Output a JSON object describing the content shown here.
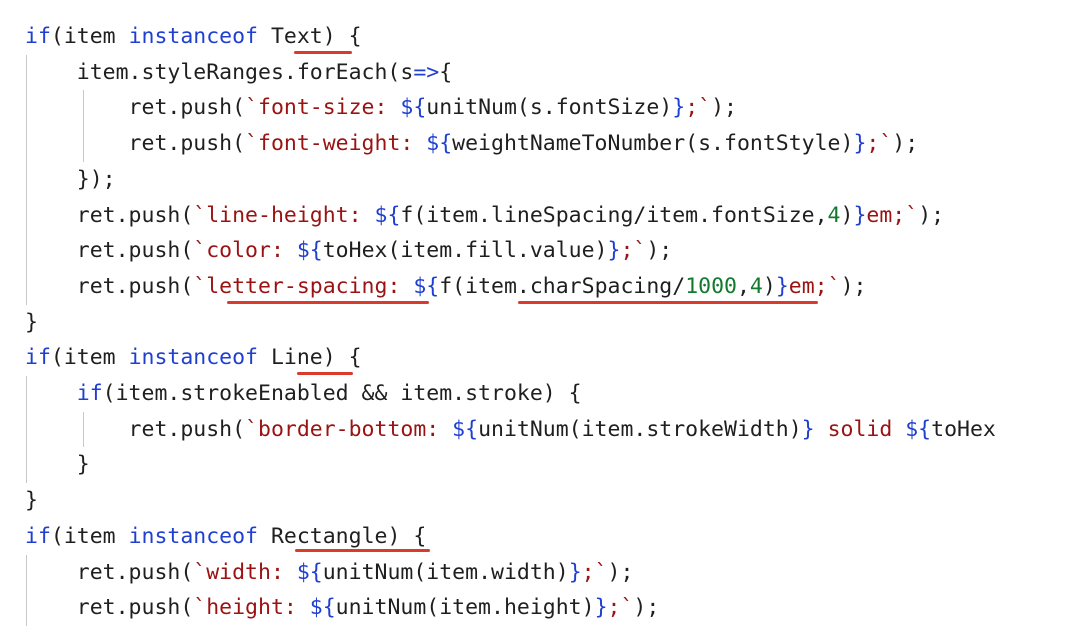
{
  "editor": {
    "lines": [
      [
        [
          "kw",
          "if"
        ],
        [
          "plain",
          "(item "
        ],
        [
          "kw",
          "instanceof"
        ],
        [
          "plain",
          " Text) {"
        ]
      ],
      [
        [
          "plain",
          "    item.styleRanges.forEach(s"
        ],
        [
          "kw",
          "=>"
        ],
        [
          "plain",
          "{"
        ]
      ],
      [
        [
          "plain",
          "        ret.push("
        ],
        [
          "str",
          "`font-size: "
        ],
        [
          "tpl",
          "${"
        ],
        [
          "plain",
          "unitNum(s.fontSize)"
        ],
        [
          "tpl",
          "}"
        ],
        [
          "str",
          ";`"
        ],
        [
          "plain",
          ");"
        ]
      ],
      [
        [
          "plain",
          "        ret.push("
        ],
        [
          "str",
          "`font-weight: "
        ],
        [
          "tpl",
          "${"
        ],
        [
          "plain",
          "weightNameToNumber(s.fontStyle)"
        ],
        [
          "tpl",
          "}"
        ],
        [
          "str",
          ";`"
        ],
        [
          "plain",
          ");"
        ]
      ],
      [
        [
          "plain",
          "    });"
        ]
      ],
      [
        [
          "plain",
          "    ret.push("
        ],
        [
          "str",
          "`line-height: "
        ],
        [
          "tpl",
          "${"
        ],
        [
          "plain",
          "f(item.lineSpacing/item.fontSize,"
        ],
        [
          "num",
          "4"
        ],
        [
          "plain",
          ")"
        ],
        [
          "tpl",
          "}"
        ],
        [
          "str",
          "em;`"
        ],
        [
          "plain",
          ");"
        ]
      ],
      [
        [
          "plain",
          "    ret.push("
        ],
        [
          "str",
          "`color: "
        ],
        [
          "tpl",
          "${"
        ],
        [
          "plain",
          "toHex(item.fill.value)"
        ],
        [
          "tpl",
          "}"
        ],
        [
          "str",
          ";`"
        ],
        [
          "plain",
          ");"
        ]
      ],
      [
        [
          "plain",
          "    ret.push("
        ],
        [
          "str",
          "`letter-spacing: "
        ],
        [
          "tpl",
          "${"
        ],
        [
          "plain",
          "f(item.charSpacing/"
        ],
        [
          "num",
          "1000"
        ],
        [
          "plain",
          ","
        ],
        [
          "num",
          "4"
        ],
        [
          "plain",
          ")"
        ],
        [
          "tpl",
          "}"
        ],
        [
          "str",
          "em;`"
        ],
        [
          "plain",
          ");"
        ]
      ],
      [
        [
          "plain",
          "}"
        ]
      ],
      [
        [
          "kw",
          "if"
        ],
        [
          "plain",
          "(item "
        ],
        [
          "kw",
          "instanceof"
        ],
        [
          "plain",
          " Line) {"
        ]
      ],
      [
        [
          "plain",
          "    "
        ],
        [
          "kw",
          "if"
        ],
        [
          "plain",
          "(item.strokeEnabled && item.stroke) {"
        ]
      ],
      [
        [
          "plain",
          "        ret.push("
        ],
        [
          "str",
          "`border-bottom: "
        ],
        [
          "tpl",
          "${"
        ],
        [
          "plain",
          "unitNum(item.strokeWidth)"
        ],
        [
          "tpl",
          "}"
        ],
        [
          "str",
          " solid "
        ],
        [
          "tpl",
          "${"
        ],
        [
          "plain",
          "toHex"
        ]
      ],
      [
        [
          "plain",
          "    }"
        ]
      ],
      [
        [
          "plain",
          "}"
        ]
      ],
      [
        [
          "kw",
          "if"
        ],
        [
          "plain",
          "(item "
        ],
        [
          "kw",
          "instanceof"
        ],
        [
          "plain",
          " Rectangle) {"
        ]
      ],
      [
        [
          "plain",
          "    ret.push("
        ],
        [
          "str",
          "`width: "
        ],
        [
          "tpl",
          "${"
        ],
        [
          "plain",
          "unitNum(item.width)"
        ],
        [
          "tpl",
          "}"
        ],
        [
          "str",
          ";`"
        ],
        [
          "plain",
          ");"
        ]
      ],
      [
        [
          "plain",
          "    ret.push("
        ],
        [
          "str",
          "`height: "
        ],
        [
          "tpl",
          "${"
        ],
        [
          "plain",
          "unitNum(item.height)"
        ],
        [
          "tpl",
          "}"
        ],
        [
          "str",
          ";`"
        ],
        [
          "plain",
          ");"
        ]
      ]
    ]
  }
}
